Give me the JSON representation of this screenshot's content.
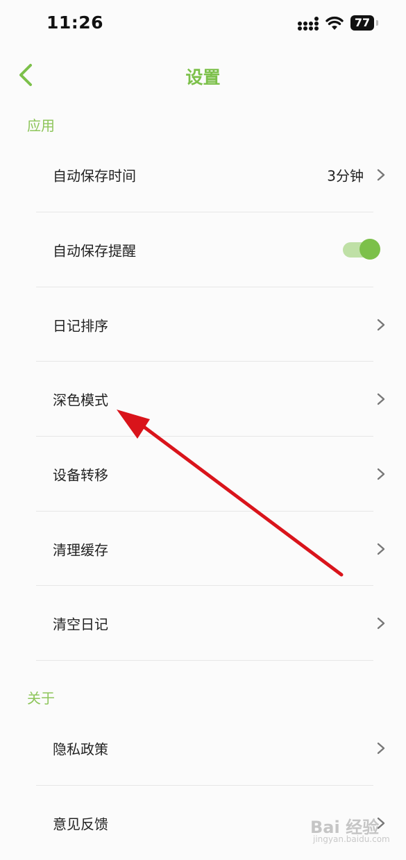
{
  "status_bar": {
    "time": "11:26",
    "battery": "77"
  },
  "nav": {
    "title": "设置"
  },
  "sections": [
    {
      "header": "应用",
      "items": [
        {
          "label": "自动保存时间",
          "value": "3分钟"
        },
        {
          "label": "自动保存提醒",
          "toggle_on": true
        },
        {
          "label": "日记排序"
        },
        {
          "label": "深色模式"
        },
        {
          "label": "设备转移"
        },
        {
          "label": "清理缓存"
        },
        {
          "label": "清空日记"
        }
      ]
    },
    {
      "header": "关于",
      "items": [
        {
          "label": "隐私政策"
        },
        {
          "label": "意见反馈"
        }
      ]
    }
  ],
  "watermark": {
    "brand": "Bai  经验",
    "url": "jingyan.baidu.com"
  },
  "colors": {
    "accent": "#7cc04a",
    "section_header": "#8dc55a",
    "annotation_arrow": "#d9141b"
  }
}
